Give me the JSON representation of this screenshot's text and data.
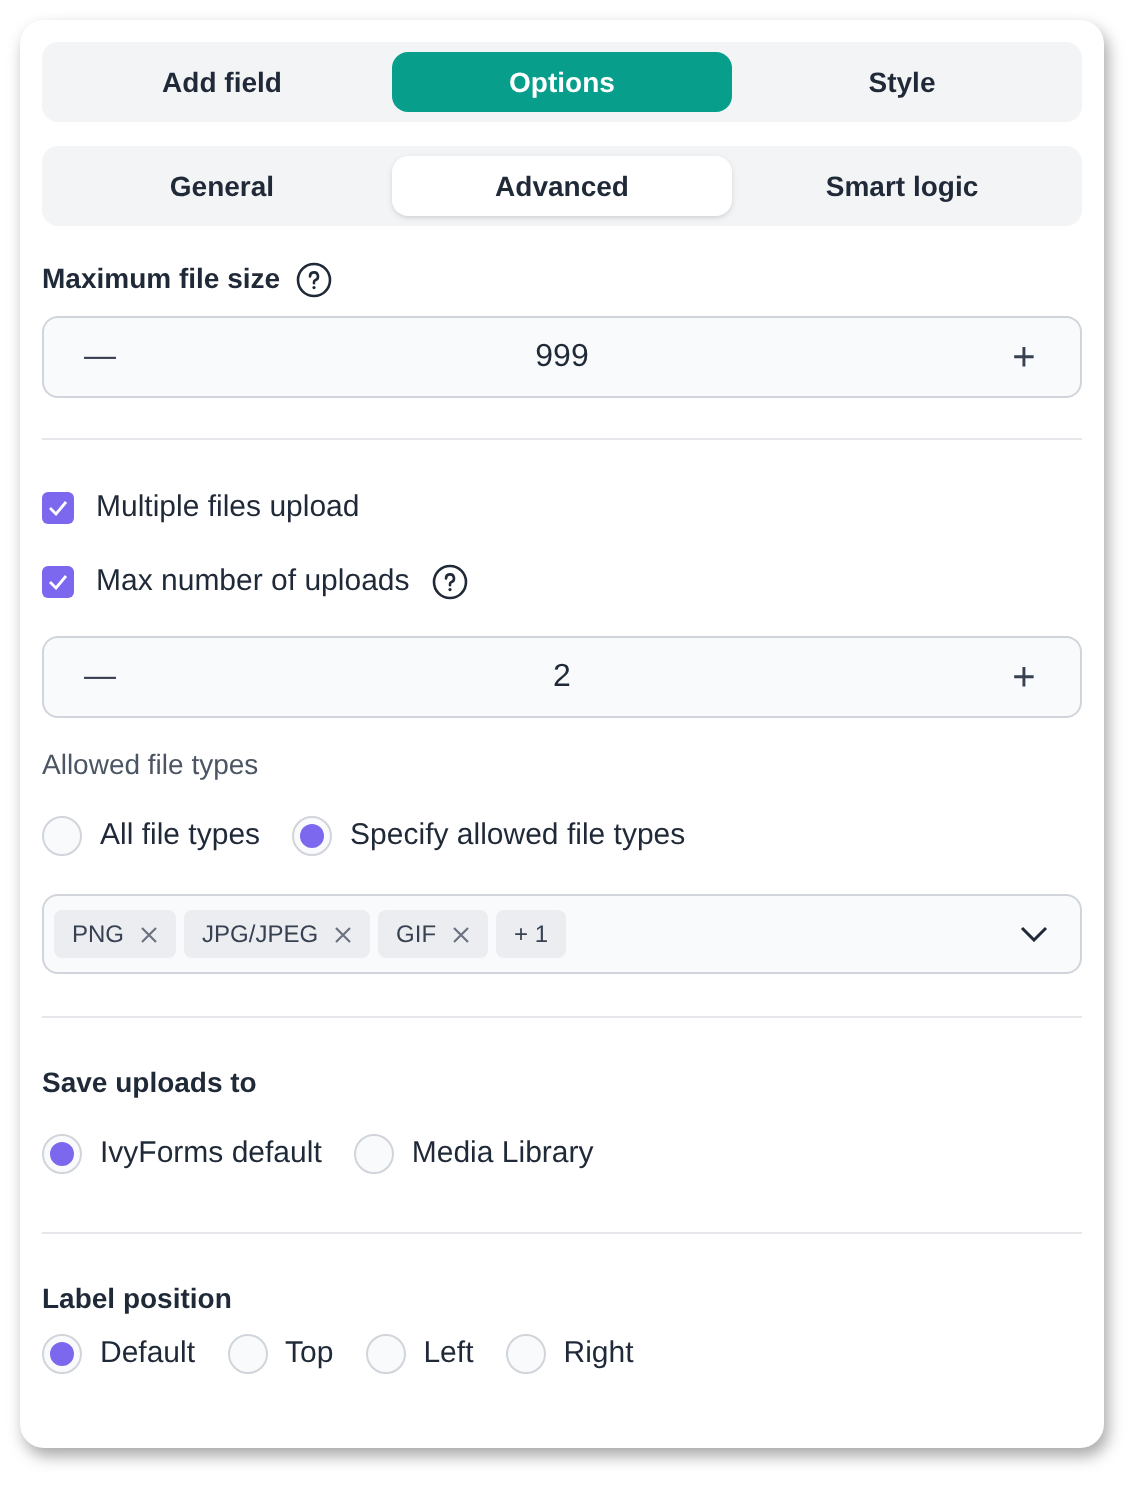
{
  "main_tabs": [
    {
      "label": "Add field",
      "selected": false
    },
    {
      "label": "Options",
      "selected": true
    },
    {
      "label": "Style",
      "selected": false
    }
  ],
  "sub_tabs": [
    {
      "label": "General",
      "selected": false
    },
    {
      "label": "Advanced",
      "selected": true
    },
    {
      "label": "Smart logic",
      "selected": false
    }
  ],
  "max_file_size": {
    "label": "Maximum file size",
    "minus": "—",
    "value": "999",
    "plus": "+"
  },
  "checkboxes": [
    {
      "label": "Multiple files upload",
      "checked": true,
      "help": false
    },
    {
      "label": "Max number of uploads",
      "checked": true,
      "help": true
    }
  ],
  "max_uploads": {
    "minus": "—",
    "value": "2",
    "plus": "+"
  },
  "allowed_types": {
    "label": "Allowed file types",
    "options": [
      {
        "label": "All file types",
        "selected": false
      },
      {
        "label": "Specify allowed file types",
        "selected": true
      }
    ],
    "tags": [
      {
        "label": "PNG",
        "removable": true
      },
      {
        "label": "JPG/JPEG",
        "removable": true
      },
      {
        "label": "GIF",
        "removable": true
      },
      {
        "label": "+ 1",
        "removable": false
      }
    ]
  },
  "save_uploads": {
    "label": "Save uploads to",
    "options": [
      {
        "label": "IvyForms default",
        "selected": true
      },
      {
        "label": "Media Library",
        "selected": false
      }
    ]
  },
  "label_position": {
    "label": "Label position",
    "options": [
      {
        "label": "Default",
        "selected": true
      },
      {
        "label": "Top",
        "selected": false
      },
      {
        "label": "Left",
        "selected": false
      },
      {
        "label": "Right",
        "selected": false
      }
    ]
  }
}
